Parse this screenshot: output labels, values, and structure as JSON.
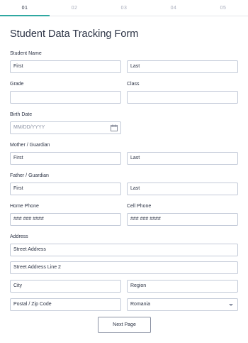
{
  "steps": [
    "01",
    "02",
    "03",
    "04",
    "05"
  ],
  "form": {
    "title": "Student Data Tracking Form",
    "student_name": {
      "label": "Student Name",
      "first": "First",
      "last": "Last"
    },
    "grade": {
      "label": "Grade",
      "value": ""
    },
    "class": {
      "label": "Class",
      "value": ""
    },
    "birth_date": {
      "label": "Birth Date",
      "placeholder": "MM/DD/YYYY"
    },
    "mother": {
      "label": "Mother / Guardian",
      "first": "First",
      "last": "Last"
    },
    "father": {
      "label": "Father / Guardian",
      "first": "First",
      "last": "Last"
    },
    "home_phone": {
      "label": "Home Phone",
      "placeholder": "### ### ####"
    },
    "cell_phone": {
      "label": "Cell Phone",
      "placeholder": "### ### ####"
    },
    "address": {
      "label": "Address",
      "street": "Street Address",
      "street2": "Street Address Line 2",
      "city": "City",
      "region": "Region",
      "postal": "Postal / Zip Code",
      "country": "Romania"
    },
    "next_label": "Next Page"
  },
  "colors": {
    "accent": "#2fa8a1",
    "border": "#c3cad8",
    "text": "#2c3345"
  }
}
